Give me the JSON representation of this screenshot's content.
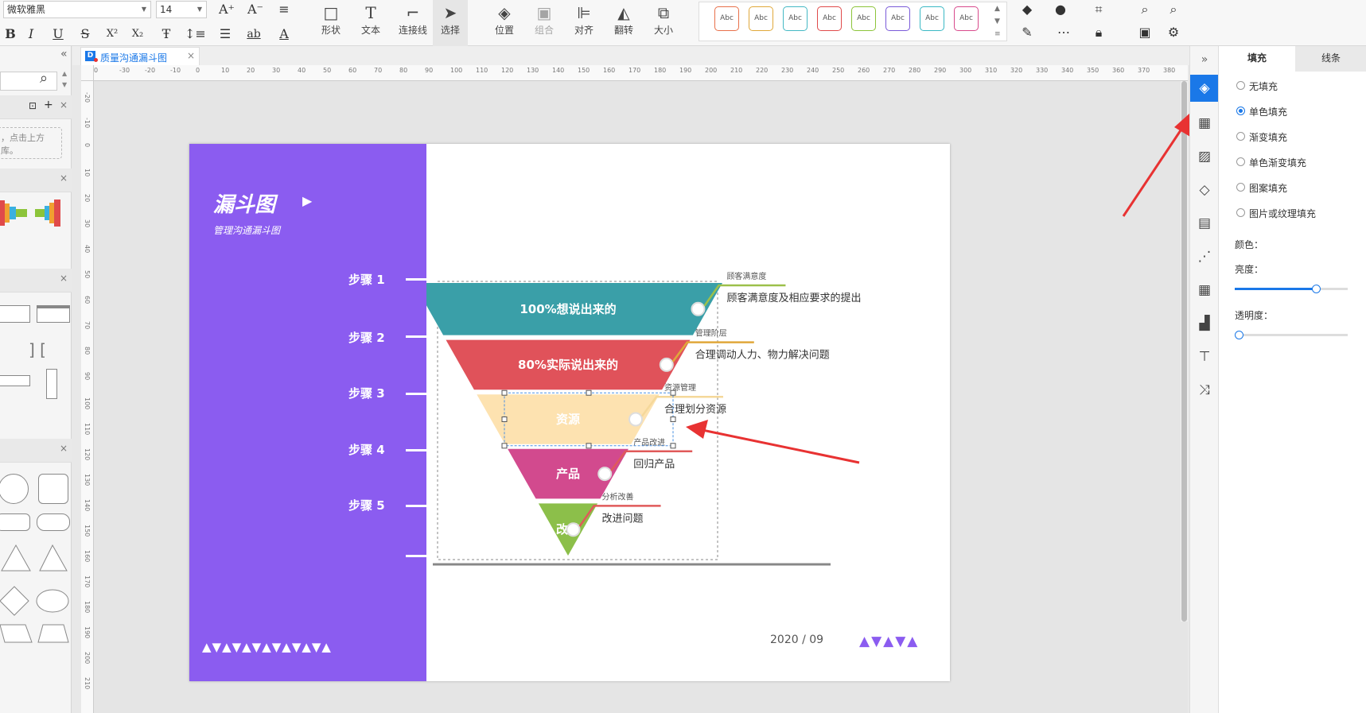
{
  "toolbar": {
    "font_family": "微软雅黑",
    "font_size": "14",
    "tools": [
      {
        "label": "形状",
        "icon": "shape-icon"
      },
      {
        "label": "文本",
        "icon": "text-icon"
      },
      {
        "label": "连接线",
        "icon": "connector-icon"
      },
      {
        "label": "选择",
        "icon": "select-icon"
      },
      {
        "label": "位置",
        "icon": "position-icon"
      },
      {
        "label": "组合",
        "icon": "group-icon"
      },
      {
        "label": "对齐",
        "icon": "align-icon"
      },
      {
        "label": "翻转",
        "icon": "flip-icon"
      },
      {
        "label": "大小",
        "icon": "size-icon"
      }
    ],
    "style_swatch_label": "Abc",
    "style_colors": [
      "#e8704a",
      "#e0a83a",
      "#44b8c4",
      "#e04a4a",
      "#8cc43a",
      "#7a5ad8",
      "#3ab8c4",
      "#d84a8c"
    ]
  },
  "left_panel": {
    "hint_text": "，点击上方",
    "hint_text2": "库。"
  },
  "tab": {
    "title": "质量沟通漏斗图"
  },
  "ruler": {
    "top_labels": [
      "0",
      "-30",
      "-20",
      "-10",
      "0",
      "10",
      "20",
      "30",
      "40",
      "50",
      "60",
      "70",
      "80",
      "90",
      "100",
      "110",
      "120",
      "130",
      "140",
      "150",
      "160",
      "170",
      "180",
      "190",
      "200",
      "210",
      "220",
      "230",
      "240",
      "250",
      "260",
      "270",
      "280",
      "290",
      "300",
      "310",
      "320",
      "330",
      "340",
      "350",
      "360",
      "370",
      "380"
    ],
    "left_labels": [
      "-20",
      "-10",
      "0",
      "10",
      "20",
      "30",
      "40",
      "50",
      "60",
      "70",
      "80",
      "90",
      "100",
      "110",
      "120",
      "130",
      "140",
      "150",
      "160",
      "170",
      "180",
      "190",
      "200",
      "210"
    ]
  },
  "diagram": {
    "title": "漏斗图",
    "subtitle": "管理沟通漏斗图",
    "steps": [
      "步骤 1",
      "步骤 2",
      "步骤 3",
      "步骤 4",
      "步骤 5"
    ],
    "date": "2020 / 09",
    "layers": [
      {
        "label": "100%想说出来的",
        "color": "#3a9fa8",
        "tag": "顾客满意度",
        "desc": "顾客满意度及相应要求的提出",
        "line_color": "#9cc04a"
      },
      {
        "label": "80%实际说出来的",
        "color": "#e0525a",
        "tag": "管理阶层",
        "desc": "合理调动人力、物力解决问题",
        "line_color": "#e0a83a"
      },
      {
        "label": "资源",
        "color": "#fde2b0",
        "tag": "资源管理",
        "desc": "合理划分资源",
        "line_color": "#f5d89a"
      },
      {
        "label": "产品",
        "color": "#d24a8e",
        "tag": "产品改进",
        "desc": "回归产品",
        "line_color": "#e05a5a"
      },
      {
        "label": "改善",
        "color": "#8cbf4a",
        "tag": "分析改善",
        "desc": "改进问题",
        "line_color": "#e05a5a"
      }
    ]
  },
  "props_panel": {
    "tabs": [
      "填充",
      "线条"
    ],
    "fill_options": [
      "无填充",
      "单色填充",
      "渐变填充",
      "单色渐变填充",
      "图案填充",
      "图片或纹理填充"
    ],
    "selected_fill_index": 1,
    "color_label": "颜色：",
    "brightness_label": "亮度：",
    "brightness_value": 0.72,
    "transparency_label": "透明度：",
    "transparency_value": 0.0
  },
  "colors": {
    "accent": "#1a78e8",
    "purple": "#8b5cf0",
    "annotation_red": "#e83232"
  }
}
